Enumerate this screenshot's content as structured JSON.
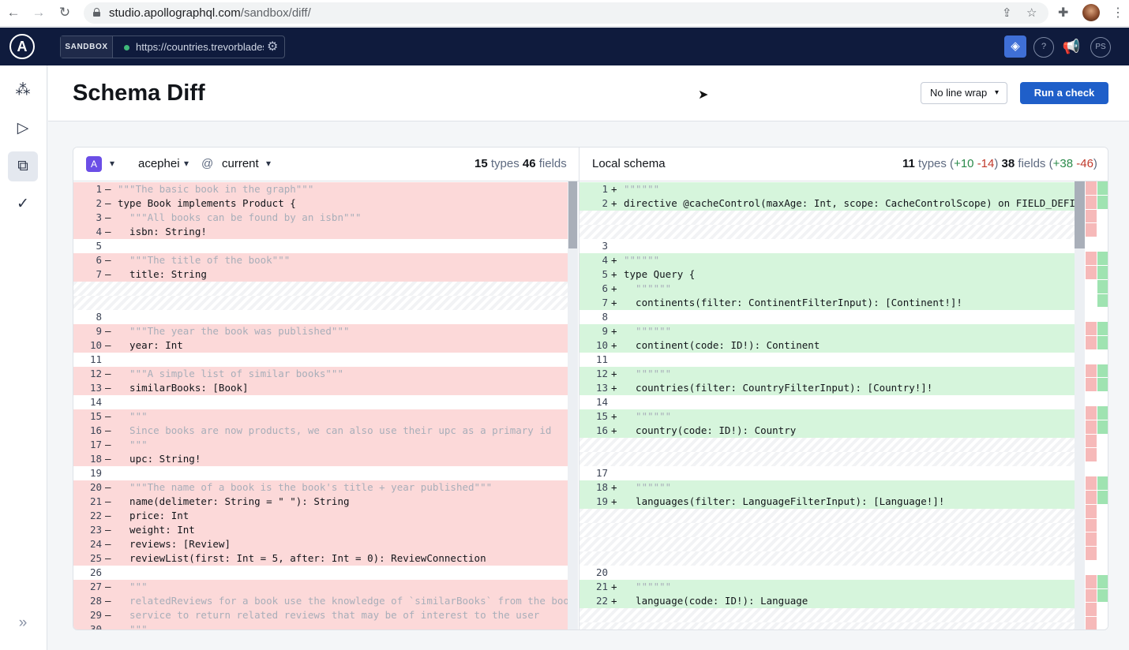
{
  "browser": {
    "url_host": "studio.apollographql.com",
    "url_path": "/sandbox/diff/"
  },
  "topbar": {
    "logo_letter": "A",
    "sandbox_label": "SANDBOX",
    "endpoint": "https://countries.trevorblades.com",
    "avatar_initials": "PS"
  },
  "header": {
    "title": "Schema Diff",
    "wrap_select": "No line wrap",
    "run_check": "Run a check"
  },
  "left_pane": {
    "graph": "acephei",
    "at": "@",
    "variant": "current",
    "types_count": "15",
    "types_label": "types",
    "fields_count": "46",
    "fields_label": "fields",
    "rows": [
      {
        "n": "1",
        "m": "—",
        "k": "del",
        "t": "\"\"\"The basic book in the graph\"\"\"",
        "c": "com"
      },
      {
        "n": "2",
        "m": "—",
        "k": "del",
        "t": "type Book implements Product {",
        "c": ""
      },
      {
        "n": "3",
        "m": "—",
        "k": "del",
        "t": "  \"\"\"All books can be found by an isbn\"\"\"",
        "c": "com"
      },
      {
        "n": "4",
        "m": "—",
        "k": "del",
        "t": "  isbn: String!",
        "c": ""
      },
      {
        "n": "5",
        "m": "",
        "k": "ctx",
        "t": "",
        "c": ""
      },
      {
        "n": "6",
        "m": "—",
        "k": "del",
        "t": "  \"\"\"The title of the book\"\"\"",
        "c": "com"
      },
      {
        "n": "7",
        "m": "—",
        "k": "del",
        "t": "  title: String",
        "c": ""
      },
      {
        "n": "",
        "m": "",
        "k": "gap",
        "t": "",
        "c": ""
      },
      {
        "n": "",
        "m": "",
        "k": "gap",
        "t": "",
        "c": ""
      },
      {
        "n": "8",
        "m": "",
        "k": "ctx",
        "t": "",
        "c": ""
      },
      {
        "n": "9",
        "m": "—",
        "k": "del",
        "t": "  \"\"\"The year the book was published\"\"\"",
        "c": "com"
      },
      {
        "n": "10",
        "m": "—",
        "k": "del",
        "t": "  year: Int",
        "c": ""
      },
      {
        "n": "11",
        "m": "",
        "k": "ctx",
        "t": "",
        "c": ""
      },
      {
        "n": "12",
        "m": "—",
        "k": "del",
        "t": "  \"\"\"A simple list of similar books\"\"\"",
        "c": "com"
      },
      {
        "n": "13",
        "m": "—",
        "k": "del",
        "t": "  similarBooks: [Book]",
        "c": ""
      },
      {
        "n": "14",
        "m": "",
        "k": "ctx",
        "t": "",
        "c": ""
      },
      {
        "n": "15",
        "m": "—",
        "k": "del",
        "t": "  \"\"\"",
        "c": "com"
      },
      {
        "n": "16",
        "m": "—",
        "k": "del",
        "t": "  Since books are now products, we can also use their upc as a primary id",
        "c": "com"
      },
      {
        "n": "17",
        "m": "—",
        "k": "del",
        "t": "  \"\"\"",
        "c": "com"
      },
      {
        "n": "18",
        "m": "—",
        "k": "del",
        "t": "  upc: String!",
        "c": ""
      },
      {
        "n": "19",
        "m": "",
        "k": "ctx",
        "t": "",
        "c": ""
      },
      {
        "n": "20",
        "m": "—",
        "k": "del",
        "t": "  \"\"\"The name of a book is the book's title + year published\"\"\"",
        "c": "com"
      },
      {
        "n": "21",
        "m": "—",
        "k": "del",
        "t": "  name(delimeter: String = \" \"): String",
        "c": ""
      },
      {
        "n": "22",
        "m": "—",
        "k": "del",
        "t": "  price: Int",
        "c": ""
      },
      {
        "n": "23",
        "m": "—",
        "k": "del",
        "t": "  weight: Int",
        "c": ""
      },
      {
        "n": "24",
        "m": "—",
        "k": "del",
        "t": "  reviews: [Review]",
        "c": ""
      },
      {
        "n": "25",
        "m": "—",
        "k": "del",
        "t": "  reviewList(first: Int = 5, after: Int = 0): ReviewConnection",
        "c": ""
      },
      {
        "n": "26",
        "m": "",
        "k": "ctx",
        "t": "",
        "c": ""
      },
      {
        "n": "27",
        "m": "—",
        "k": "del",
        "t": "  \"\"\"",
        "c": "com"
      },
      {
        "n": "28",
        "m": "—",
        "k": "del",
        "t": "  relatedReviews for a book use the knowledge of `similarBooks` from the books",
        "c": "com"
      },
      {
        "n": "29",
        "m": "—",
        "k": "del",
        "t": "  service to return related reviews that may be of interest to the user",
        "c": "com"
      },
      {
        "n": "30",
        "m": "—",
        "k": "del",
        "t": "  \"\"\"",
        "c": "com"
      }
    ]
  },
  "right_pane": {
    "title": "Local schema",
    "types_count": "11",
    "types_label": "types",
    "types_added": "+10",
    "types_removed": "-14",
    "fields_count": "38",
    "fields_label": "fields",
    "fields_added": "+38",
    "fields_removed": "-46",
    "rows": [
      {
        "n": "1",
        "m": "+",
        "k": "add",
        "t": "\"\"\"\"\"\"",
        "c": "com"
      },
      {
        "n": "2",
        "m": "+",
        "k": "add",
        "t": "directive @cacheControl(maxAge: Int, scope: CacheControlScope) on FIELD_DEFINITION",
        "c": ""
      },
      {
        "n": "",
        "m": "",
        "k": "gap",
        "t": "",
        "c": ""
      },
      {
        "n": "",
        "m": "",
        "k": "gap",
        "t": "",
        "c": ""
      },
      {
        "n": "3",
        "m": "",
        "k": "ctx",
        "t": "",
        "c": ""
      },
      {
        "n": "4",
        "m": "+",
        "k": "add",
        "t": "\"\"\"\"\"\"",
        "c": "com"
      },
      {
        "n": "5",
        "m": "+",
        "k": "add",
        "t": "type Query {",
        "c": ""
      },
      {
        "n": "6",
        "m": "+",
        "k": "add",
        "t": "  \"\"\"\"\"\"",
        "c": "com"
      },
      {
        "n": "7",
        "m": "+",
        "k": "add",
        "t": "  continents(filter: ContinentFilterInput): [Continent!]!",
        "c": ""
      },
      {
        "n": "8",
        "m": "",
        "k": "ctx",
        "t": "",
        "c": ""
      },
      {
        "n": "9",
        "m": "+",
        "k": "add",
        "t": "  \"\"\"\"\"\"",
        "c": "com"
      },
      {
        "n": "10",
        "m": "+",
        "k": "add",
        "t": "  continent(code: ID!): Continent",
        "c": ""
      },
      {
        "n": "11",
        "m": "",
        "k": "ctx",
        "t": "",
        "c": ""
      },
      {
        "n": "12",
        "m": "+",
        "k": "add",
        "t": "  \"\"\"\"\"\"",
        "c": "com"
      },
      {
        "n": "13",
        "m": "+",
        "k": "add",
        "t": "  countries(filter: CountryFilterInput): [Country!]!",
        "c": ""
      },
      {
        "n": "14",
        "m": "",
        "k": "ctx",
        "t": "",
        "c": ""
      },
      {
        "n": "15",
        "m": "+",
        "k": "add",
        "t": "  \"\"\"\"\"\"",
        "c": "com"
      },
      {
        "n": "16",
        "m": "+",
        "k": "add",
        "t": "  country(code: ID!): Country",
        "c": ""
      },
      {
        "n": "",
        "m": "",
        "k": "gap",
        "t": "",
        "c": ""
      },
      {
        "n": "",
        "m": "",
        "k": "gap",
        "t": "",
        "c": ""
      },
      {
        "n": "17",
        "m": "",
        "k": "ctx",
        "t": "",
        "c": ""
      },
      {
        "n": "18",
        "m": "+",
        "k": "add",
        "t": "  \"\"\"\"\"\"",
        "c": "com"
      },
      {
        "n": "19",
        "m": "+",
        "k": "add",
        "t": "  languages(filter: LanguageFilterInput): [Language!]!",
        "c": ""
      },
      {
        "n": "",
        "m": "",
        "k": "gap",
        "t": "",
        "c": ""
      },
      {
        "n": "",
        "m": "",
        "k": "gap",
        "t": "",
        "c": ""
      },
      {
        "n": "",
        "m": "",
        "k": "gap",
        "t": "",
        "c": ""
      },
      {
        "n": "",
        "m": "",
        "k": "gap",
        "t": "",
        "c": ""
      },
      {
        "n": "20",
        "m": "",
        "k": "ctx",
        "t": "",
        "c": ""
      },
      {
        "n": "21",
        "m": "+",
        "k": "add",
        "t": "  \"\"\"\"\"\"",
        "c": "com"
      },
      {
        "n": "22",
        "m": "+",
        "k": "add",
        "t": "  language(code: ID!): Language",
        "c": ""
      },
      {
        "n": "",
        "m": "",
        "k": "gap",
        "t": "",
        "c": ""
      },
      {
        "n": "",
        "m": "",
        "k": "gap",
        "t": "",
        "c": ""
      }
    ]
  },
  "colors": {
    "deleted": "#fcd9d9",
    "added": "#d6f5dc",
    "topbar": "#0f1b3d",
    "primary": "#1f5fc9"
  },
  "icons": [
    "back-arrow-icon",
    "forward-arrow-icon",
    "reload-icon",
    "lock-icon",
    "share-icon",
    "star-icon",
    "extensions-icon",
    "more-icon",
    "graph-icon",
    "play-icon",
    "diff-icon",
    "check-icon",
    "expand-icon",
    "gear-icon",
    "help-icon",
    "megaphone-icon",
    "mouse-cursor-icon"
  ]
}
